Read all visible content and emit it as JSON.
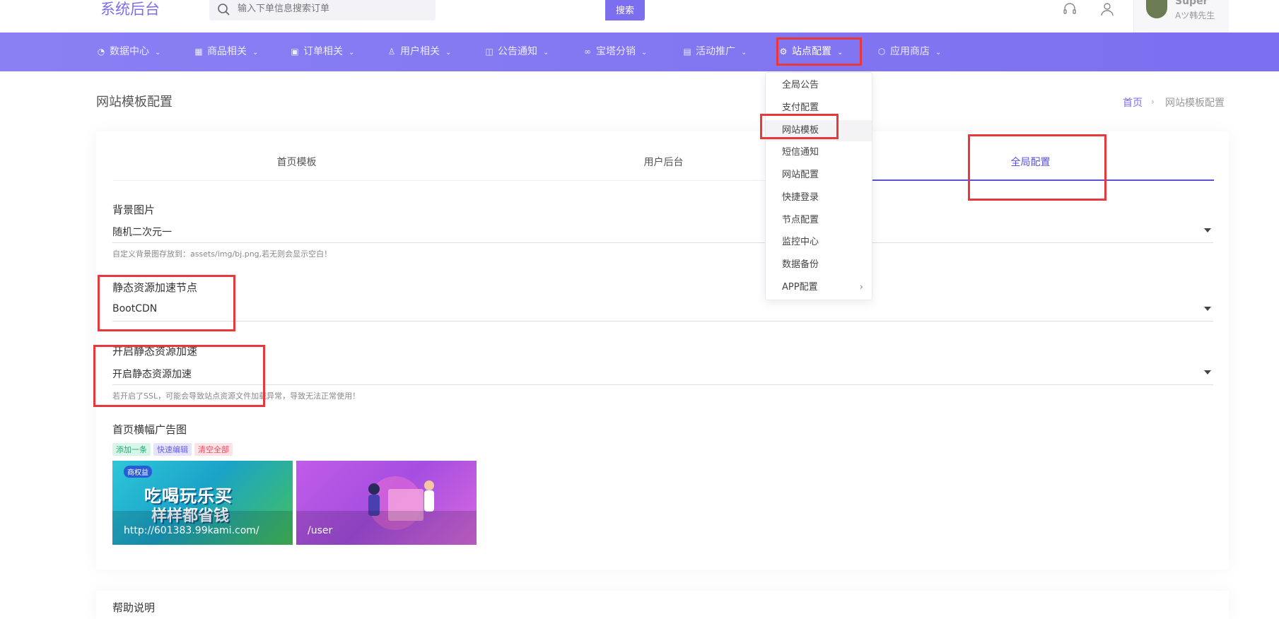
{
  "brand": "系统后台",
  "search": {
    "placeholder": "输入下单信息搜索订单",
    "button": "搜索"
  },
  "user": {
    "name": "Super",
    "role": "Aツ韩先生"
  },
  "nav": [
    {
      "label": "数据中心",
      "icon": "dashboard-icon"
    },
    {
      "label": "商品相关",
      "icon": "grid-icon"
    },
    {
      "label": "订单相关",
      "icon": "order-icon"
    },
    {
      "label": "用户相关",
      "icon": "user-icon"
    },
    {
      "label": "公告通知",
      "icon": "book-icon"
    },
    {
      "label": "宝塔分销",
      "icon": "share-icon"
    },
    {
      "label": "活动推广",
      "icon": "gift-icon"
    },
    {
      "label": "站点配置",
      "icon": "gear-icon"
    },
    {
      "label": "应用商店",
      "icon": "cube-icon"
    }
  ],
  "dropdown": {
    "items": [
      "全局公告",
      "支付配置",
      "网站模板",
      "短信通知",
      "网站配置",
      "快捷登录",
      "节点配置",
      "监控中心",
      "数据备份",
      "APP配置"
    ],
    "more": "›"
  },
  "page": {
    "title": "网站模板配置",
    "breadcrumb": {
      "home": "首页",
      "sep": "›",
      "current": "网站模板配置"
    }
  },
  "tabs": [
    "首页模板",
    "用户后台",
    "全局配置"
  ],
  "fields": {
    "bg": {
      "label": "背景图片",
      "value": "随机二次元一",
      "help": "自定义背景图存放到：assets/img/bj.png,若无则会显示空白！"
    },
    "cdn": {
      "label": "静态资源加速节点",
      "value": "BootCDN"
    },
    "accel": {
      "label": "开启静态资源加速",
      "value": "开启静态资源加速",
      "help": "若开启了SSL，可能会导致站点资源文件加载异常，导致无法正常使用！"
    }
  },
  "banner": {
    "label": "首页横幅广告图",
    "actions": {
      "add": "添加一条",
      "edit": "快速编辑",
      "clear": "清空全部"
    },
    "items": [
      {
        "url": "http://601383.99kami.com/",
        "title": "吃喝玩乐买",
        "subtitle": "样样都省钱",
        "tag": "商权益"
      },
      {
        "url": "/user"
      }
    ]
  },
  "help_section": {
    "title": "帮助说明"
  },
  "colors": {
    "accent": "#7b6ff0",
    "annotation": "#e8383b"
  }
}
